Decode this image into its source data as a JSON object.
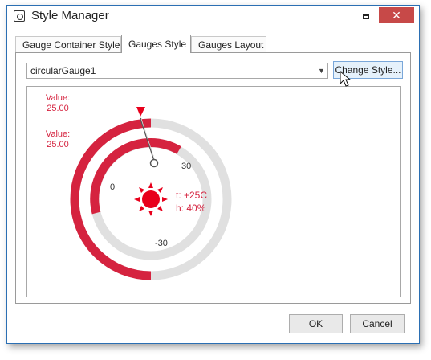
{
  "window": {
    "title": "Style Manager",
    "close_glyph": "✕"
  },
  "tabs": [
    {
      "label": "Gauge Container Style"
    },
    {
      "label": "Gauges Style"
    },
    {
      "label": "Gauges Layout"
    }
  ],
  "gauge_selector": {
    "value": "circularGauge1",
    "dropdown_icon": "chevron-down-icon"
  },
  "change_style_label": "Change Style...",
  "preview": {
    "value1": {
      "label": "Value:",
      "number": "25.00"
    },
    "value2": {
      "label": "Value:",
      "number": "25.00"
    },
    "scale_labels": {
      "zero": "0",
      "thirty": "30",
      "minus_thirty": "-30"
    },
    "info": {
      "temperature": "t: +25C",
      "humidity": "h: 40%"
    },
    "accent_color": "#d5233f",
    "track_color": "#e0e0e0"
  },
  "footer": {
    "ok_label": "OK",
    "cancel_label": "Cancel"
  }
}
